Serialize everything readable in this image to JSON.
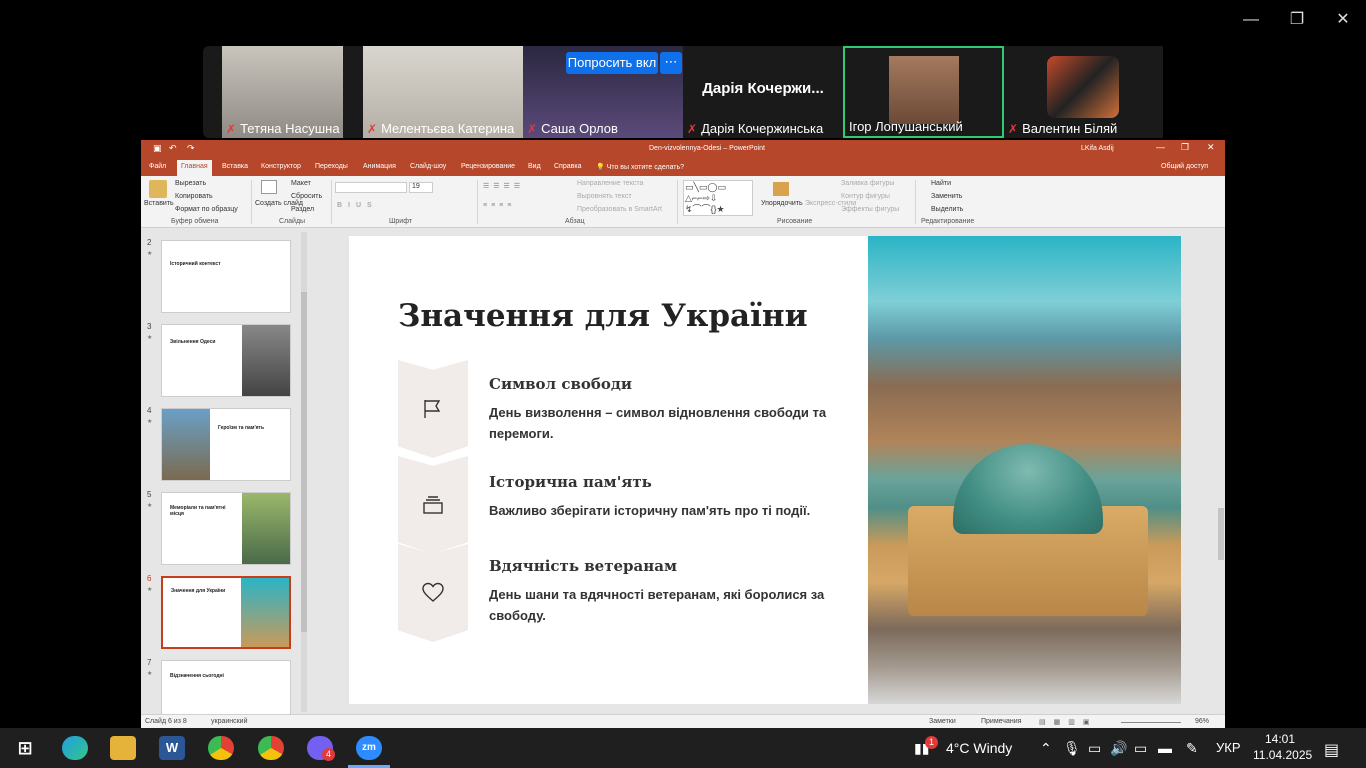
{
  "zoom": {
    "window_controls": [
      "—",
      "❐",
      "✕"
    ],
    "ask_button": "Попросить вкл",
    "more_button": "⋯",
    "participants": [
      {
        "name": "Тетяна Насушна",
        "muted": true
      },
      {
        "name": "Мелентьєва Катерина",
        "muted": true
      },
      {
        "name": "Саша Орлов",
        "muted": true
      },
      {
        "name": "Дарія Кочержинська",
        "muted": true,
        "tile_text": "Дарія Кочержи..."
      },
      {
        "name": "Ігор Лопушанський",
        "muted": false
      },
      {
        "name": "Валентин Біляй",
        "muted": true
      }
    ]
  },
  "ppt": {
    "doc_title": "Den-vizvolennya-Odesi  –  PowerPoint",
    "user": "LKifa Asdij",
    "tabs": [
      "Файл",
      "Главная",
      "Вставка",
      "Конструктор",
      "Переходы",
      "Анимация",
      "Слайд-шоу",
      "Рецензирование",
      "Вид",
      "Справка",
      "Что вы хотите сделать?",
      "Общий доступ"
    ],
    "ribbon": {
      "paste": "Вставить",
      "cut": "Вырезать",
      "copy": "Копировать",
      "format_painter": "Формат по образцу",
      "clipboard_group": "Буфер обмена",
      "new_slide": "Создать слайд",
      "layout": "Макет",
      "reset": "Сбросить",
      "section": "Раздел",
      "slides_group": "Слайды",
      "font_size": "19",
      "font_group": "Шрифт",
      "text_direction": "Направление текста",
      "align_text": "Выровнять текст",
      "smartart": "Преобразовать в SmartArt",
      "paragraph_group": "Абзац",
      "arrange": "Упорядочить",
      "quick_styles": "Экспресс-стили",
      "shape_fill": "Заливка фигуры",
      "shape_outline": "Контур фигуры",
      "shape_effects": "Эффекты фигуры",
      "drawing_group": "Рисование",
      "find": "Найти",
      "replace": "Заменить",
      "select": "Выделить",
      "editing_group": "Редактирование"
    },
    "thumbnails": [
      {
        "num": "2",
        "title": "Історичний контекст"
      },
      {
        "num": "3",
        "title": "Звільнення Одеси"
      },
      {
        "num": "4",
        "title": "Героїзм та пам'ять"
      },
      {
        "num": "5",
        "title": "Меморіали та пам'ятні місця"
      },
      {
        "num": "6",
        "title": "Значення для України"
      },
      {
        "num": "7",
        "title": "Відзначення сьогодні"
      }
    ],
    "slide": {
      "title": "Значення для України",
      "items": [
        {
          "title": "Символ свободи",
          "desc": "День визволення – символ відновлення свободи та перемоги.",
          "icon": "flag-icon"
        },
        {
          "title": "Історична пам'ять",
          "desc": "Важливо зберігати історичну пам'ять про ті події.",
          "icon": "layers-icon"
        },
        {
          "title": "Вдячність ветеранам",
          "desc": "День шани та вдячності ветеранам, які боролися за свободу.",
          "icon": "heart-icon"
        }
      ]
    },
    "status": {
      "slide_of": "Слайд 6 из 8",
      "language": "украинский",
      "notes": "Заметки",
      "comments": "Примечания",
      "zoom": "96%"
    }
  },
  "taskbar": {
    "weather": "4°C  Windy",
    "weather_badge": "1",
    "viber_badge": "4",
    "lang": "УКР",
    "time": "14:01",
    "date": "11.04.2025"
  }
}
